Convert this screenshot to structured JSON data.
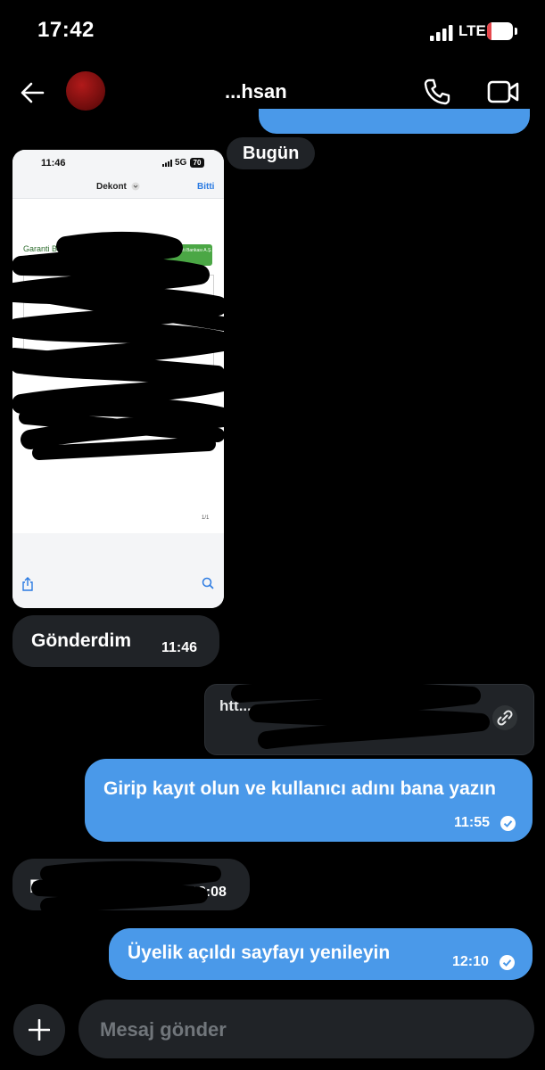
{
  "status_bar": {
    "time": "17:42",
    "network": "LTE",
    "battery": "18",
    "battery_level": 0.18,
    "battery_color": "#e5484d"
  },
  "header": {
    "contact_name": "...hsan",
    "back_icon": "arrow-left-icon",
    "call_icon": "phone-icon",
    "video_icon": "video-camera-icon"
  },
  "day_divider": "Bugün",
  "screenshot": {
    "time": "11:46",
    "network": "5G",
    "battery": "70",
    "nav_title": "Dekont",
    "nav_done": "Bitti",
    "bank_name": "Garanti BBVA",
    "bank_header": "T. Garanti Bankası A.Ş.",
    "page_num": "1/1"
  },
  "messages": [
    {
      "direction": "in",
      "text": "Gönderdim",
      "time": "11:46"
    },
    {
      "direction": "out",
      "type": "link",
      "text": "htt...",
      "link_icon": "link-icon"
    },
    {
      "direction": "out",
      "text": "Girip kayıt olun ve kullanıcı adını bana yazın",
      "time": "11:55"
    },
    {
      "direction": "in",
      "text": "Bir...",
      "time": "12:08"
    },
    {
      "direction": "out",
      "text": "Üyelik açıldı sayfayı yenileyin",
      "time": "12:10"
    }
  ],
  "composer": {
    "placeholder": "Mesaj gönder",
    "add_icon": "plus-icon"
  },
  "colors": {
    "accent": "#4a99e9",
    "incoming_bubble": "#202327",
    "background": "#000000"
  }
}
